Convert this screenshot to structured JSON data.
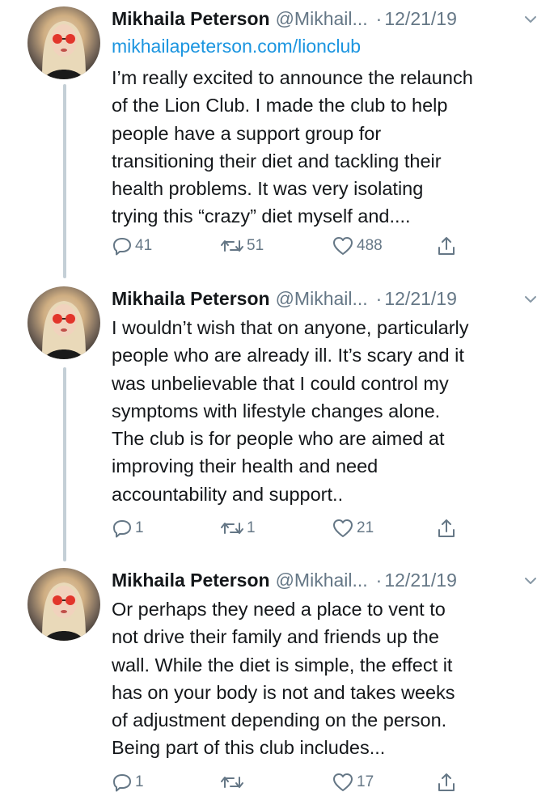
{
  "colors": {
    "link": "#1b95e0",
    "secondary_text": "#657786",
    "primary_text": "#14171a",
    "thread_line": "#c4cfd6"
  },
  "icons": {
    "reply": "reply-icon",
    "retweet": "retweet-icon",
    "like": "like-icon",
    "share": "share-icon",
    "caret": "chevron-down-icon"
  },
  "tweets": [
    {
      "author_name": "Mikhaila Peterson",
      "author_handle": "@Mikhail...",
      "separator": "·",
      "date": "12/21/19",
      "link": "mikhailapeterson.com/lionclub",
      "lines": [
        "I’m really excited to announce the relaunch",
        "of the Lion Club. I made the club to help",
        "people have a support group for",
        "transitioning their diet and tackling their",
        "health problems. It was very isolating",
        "trying this “crazy” diet myself and...."
      ],
      "replies": "41",
      "retweets": "51",
      "likes": "488"
    },
    {
      "author_name": "Mikhaila Peterson",
      "author_handle": "@Mikhail...",
      "separator": "·",
      "date": "12/21/19",
      "lines": [
        "I wouldn’t wish that on anyone, particularly",
        "people who are already ill. It’s scary and it",
        "was unbelievable that I could control my",
        "symptoms with lifestyle changes alone.",
        "The club is for people who are aimed at",
        "improving their health and need",
        "accountability and support.."
      ],
      "replies": "1",
      "retweets": "1",
      "likes": "21"
    },
    {
      "author_name": "Mikhaila Peterson",
      "author_handle": "@Mikhail...",
      "separator": "·",
      "date": "12/21/19",
      "lines": [
        "Or perhaps they need a place to vent to",
        "not drive their family and friends up the",
        "wall. While the diet is simple, the effect it",
        "has on your body is not and takes weeks",
        "of adjustment depending on the person.",
        "Being part of this club includes..."
      ],
      "replies": "1",
      "retweets": "",
      "likes": "17"
    }
  ]
}
